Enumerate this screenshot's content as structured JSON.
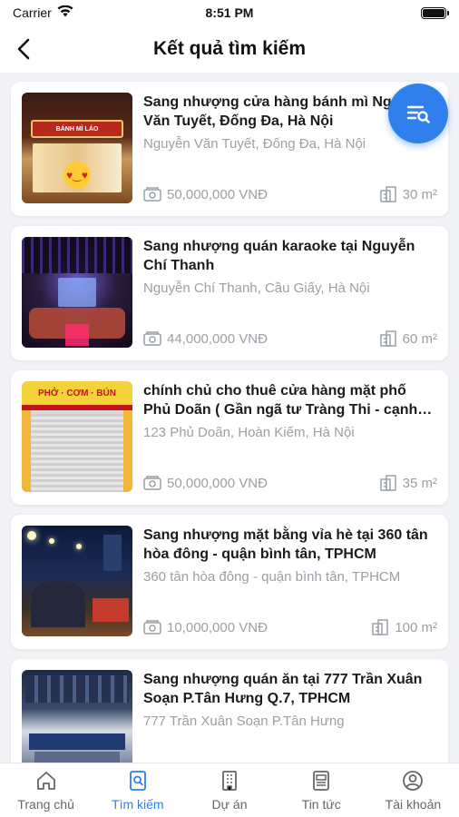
{
  "status_bar": {
    "carrier": "Carrier",
    "time": "8:51 PM"
  },
  "header": {
    "title": "Kết quả tìm kiếm"
  },
  "colors": {
    "accent": "#2f80ed",
    "muted": "#9aa0a6",
    "title": "#1b1b1b"
  },
  "listings": [
    {
      "title": "Sang nhượng cửa hàng bánh mì Nguyễn Văn Tuyết, Đống Đa, Hà Nội",
      "address": "Nguyễn Văn Tuyết, Đống Đa, Hà Nội",
      "price": "50,000,000 VNĐ",
      "area": "30 m²",
      "thumb_sign": "BÁNH MÌ LÁO"
    },
    {
      "title": "Sang nhượng quán karaoke tại Nguyễn Chí Thanh",
      "address": "Nguyễn Chí Thanh, Cầu Giấy, Hà Nội",
      "price": "44,000,000 VNĐ",
      "area": "60 m²"
    },
    {
      "title": "chính chủ cho thuê cửa hàng mặt phố Phủ Doãn ( Gần ngã tư Tràng Thi - cạnh Bệnh viện Việt Đức)",
      "address": "123 Phủ Doãn, Hoàn Kiếm, Hà Nội",
      "price": "50,000,000 VNĐ",
      "area": "35 m²",
      "thumb_sign": "PHỞ · CƠM · BÚN"
    },
    {
      "title": "Sang nhượng mặt bằng vỉa hè tại 360 tân hòa đông - quận bình tân, TPHCM",
      "address": "360 tân hòa đông - quận bình tân, TPHCM",
      "price": "10,000,000 VNĐ",
      "area": "100 m²"
    },
    {
      "title": "Sang nhượng quán ăn tại 777 Trần Xuân Soạn P.Tân Hưng Q.7, TPHCM",
      "address": "777 Trần Xuân Soạn P.Tân Hưng",
      "price": "",
      "area": ""
    }
  ],
  "tabbar": {
    "tabs": [
      {
        "label": "Trang chủ",
        "icon": "home-icon",
        "active": false
      },
      {
        "label": "Tìm kiếm",
        "icon": "search-document-icon",
        "active": true
      },
      {
        "label": "Dự án",
        "icon": "building-icon",
        "active": false
      },
      {
        "label": "Tin tức",
        "icon": "news-icon",
        "active": false
      },
      {
        "label": "Tài khoản",
        "icon": "account-icon",
        "active": false
      }
    ]
  }
}
